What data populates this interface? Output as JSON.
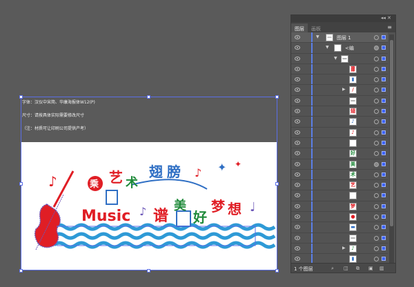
{
  "artboard": {
    "notes": [
      "字体：汉仪中宋简、华康海报体W12(P)",
      "尺寸：请按具体实际需要修改尺寸",
      "（注：材质可让印刷公司提供产考）"
    ]
  },
  "artwork": {
    "title_chars": [
      "乘",
      "艺",
      "术",
      "翅",
      "膀"
    ],
    "music_word": "Music",
    "line2_chars": [
      "谱",
      "美",
      "好",
      "梦",
      "想"
    ],
    "colors": {
      "red": "#e01e25",
      "green": "#1f8a3a",
      "blue": "#2f6fc4",
      "purple": "#6b56b8",
      "wave": "#2e9ad6"
    }
  },
  "layers_panel": {
    "tabs": [
      "图层",
      "画板"
    ],
    "collapse_icon": "double-chevron-icon",
    "menu_icon": "panel-menu-icon",
    "rows": [
      {
        "name": "图层 1",
        "thumb": "—",
        "thumb_color": "#888"
      },
      {
        "name": "<编",
        "thumb": "",
        "thumb_color": "#888"
      },
      {
        "name": "",
        "thumb": "—",
        "thumb_color": "#555"
      },
      {
        "name": "",
        "thumb": "▓",
        "thumb_color": "#e01e25"
      },
      {
        "name": "",
        "thumb": "▮",
        "thumb_color": "#2f6fc4"
      },
      {
        "name": "",
        "thumb": "/",
        "thumb_color": "#e01e25"
      },
      {
        "name": "",
        "thumb": "—",
        "thumb_color": "#555"
      },
      {
        "name": "",
        "thumb": "翅",
        "thumb_color": "#e01e25"
      },
      {
        "name": "",
        "thumb": "♪",
        "thumb_color": "#2f6fc4"
      },
      {
        "name": "",
        "thumb": "♪",
        "thumb_color": "#e01e25"
      },
      {
        "name": "",
        "thumb": "",
        "thumb_color": "#555"
      },
      {
        "name": "",
        "thumb": "好",
        "thumb_color": "#1f8a3a"
      },
      {
        "name": "",
        "thumb": "美",
        "thumb_color": "#1f8a3a"
      },
      {
        "name": "",
        "thumb": "术",
        "thumb_color": "#1f8a3a"
      },
      {
        "name": "",
        "thumb": "艺",
        "thumb_color": "#e01e25"
      },
      {
        "name": "",
        "thumb": "",
        "thumb_color": "#555"
      },
      {
        "name": "",
        "thumb": "梦",
        "thumb_color": "#e01e25"
      },
      {
        "name": "",
        "thumb": "●",
        "thumb_color": "#e01e25"
      },
      {
        "name": "",
        "thumb": "▬",
        "thumb_color": "#2f6fc4"
      },
      {
        "name": "",
        "thumb": "—",
        "thumb_color": "#555"
      },
      {
        "name": "",
        "thumb": "♪",
        "thumb_color": "#1f8a3a"
      },
      {
        "name": "",
        "thumb": "▮",
        "thumb_color": "#2f6fc4"
      }
    ],
    "layer_count": "1 个图层",
    "bottom_icons": [
      "locate-object-icon",
      "make-clipping-mask-icon",
      "new-sublayer-icon",
      "new-layer-icon",
      "delete-icon"
    ]
  }
}
